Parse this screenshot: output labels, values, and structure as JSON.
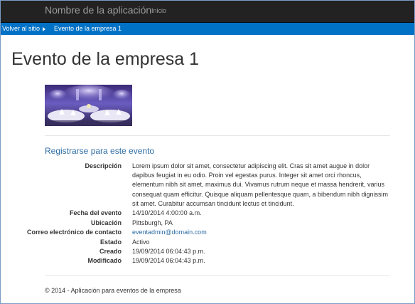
{
  "navbar": {
    "brand": "Nombre de la aplicación",
    "home_label": "Inicio"
  },
  "suitebar": {
    "back_label": "Volver al sitio",
    "current_label": "Evento de la empresa 1"
  },
  "page": {
    "title": "Evento de la empresa 1",
    "register_label": "Registrarse para este evento"
  },
  "details": {
    "description_label": "Descripción",
    "description_value": "Lorem ipsum dolor sit amet, consectetur adipiscing elit. Cras sit amet augue in dolor dapibus feugiat in eu odio. Proin vel egestas purus. Integer sit amet orci rhoncus, elementum nibh sit amet, maximus dui. Vivamus rutrum neque et massa hendrerit, varius consequat quam efficitur. Quisque aliquam pellentesque quam, a bibendum nibh dignissim sit amet. Curabitur accumsan tincidunt lectus et tincidunt.",
    "date_label": "Fecha del evento",
    "date_value": "14/10/2014 4:00:00 a.m.",
    "location_label": "Ubicación",
    "location_value": "Pittsburgh, PA",
    "email_label": "Correo electrónico de contacto",
    "email_value": "eventadmin@domain.com",
    "status_label": "Estado",
    "status_value": "Activo",
    "created_label": "Creado",
    "created_value": "19/09/2014 06:04:43 p.m.",
    "modified_label": "Modificado",
    "modified_value": "19/09/2014 06:04:43 p.m."
  },
  "footer": {
    "text": "© 2014 - Aplicación para eventos de la empresa"
  },
  "colors": {
    "navbar_bg": "#222222",
    "suitebar_bg": "#0072c6",
    "link": "#2e6da4"
  }
}
